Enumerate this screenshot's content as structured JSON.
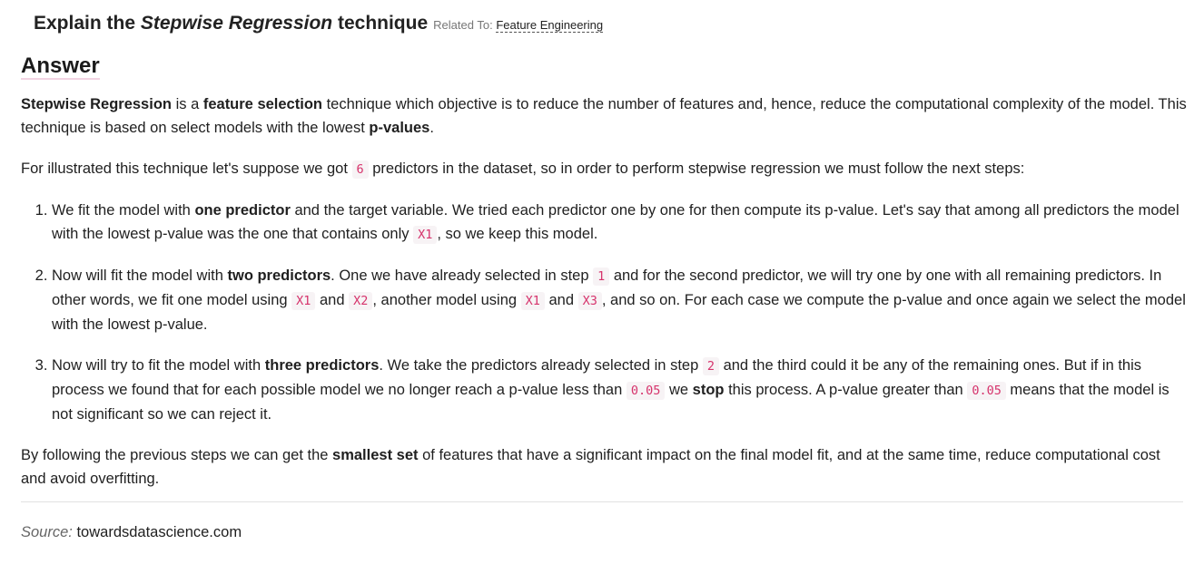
{
  "question": {
    "prefix": "Explain the",
    "emphasis": "Stepwise Regression",
    "suffix": "technique",
    "related_label": "Related To:",
    "related_link": "Feature Engineering"
  },
  "answer_heading": "Answer",
  "paragraph1": {
    "t1": "Stepwise Regression",
    "t2": " is a ",
    "t3": "feature selection",
    "t4": " technique which objective is to reduce the number of features and, hence, reduce the computational complexity of the model. This technique is based on select models with the lowest ",
    "t5": "p-values",
    "t6": "."
  },
  "paragraph2": {
    "t1": "For illustrated this technique let's suppose we got ",
    "code1": "6",
    "t2": " predictors in the dataset, so in order to perform stepwise regression we must follow the next steps:"
  },
  "steps": [
    {
      "t1": "We fit the model with ",
      "b1": "one predictor",
      "t2": " and the target variable. We tried each predictor one by one for then compute its p-value. Let's say that among all predictors the model with the lowest p-value was the one that contains only ",
      "c1": "X1",
      "t3": ", so we keep this model."
    },
    {
      "t1": "Now will fit the model with ",
      "b1": "two predictors",
      "t2": ". One we have already selected in step ",
      "c1": "1",
      "t3": " and for the second predictor, we will try one by one with all remaining predictors. In other words, we fit one model using ",
      "c2": "X1",
      "t4": " and ",
      "c3": "X2",
      "t5": ", another model using ",
      "c4": "X1",
      "t6": " and ",
      "c5": "X3",
      "t7": ", and so on. For each case we compute the p-value and once again we select the model with the lowest p-value."
    },
    {
      "t1": "Now will try to fit the model with ",
      "b1": "three predictors",
      "t2": ". We take the predictors already selected in step ",
      "c1": "2",
      "t3": " and the third could it be any of the remaining ones. But if in this process we found that for each possible model we no longer reach a p-value less than ",
      "c2": "0.05",
      "t4": " we ",
      "b2": "stop",
      "t5": " this process. A p-value greater than ",
      "c3": "0.05",
      "t6": " means that the model is not significant so we can reject it."
    }
  ],
  "paragraph3": {
    "t1": "By following the previous steps we can get the ",
    "b1": "smallest set",
    "t2": " of features that have a significant impact on the final model fit, and at the same time, reduce computational cost and avoid overfitting."
  },
  "source": {
    "label": "Source:",
    "value": "towardsdatascience.com"
  }
}
